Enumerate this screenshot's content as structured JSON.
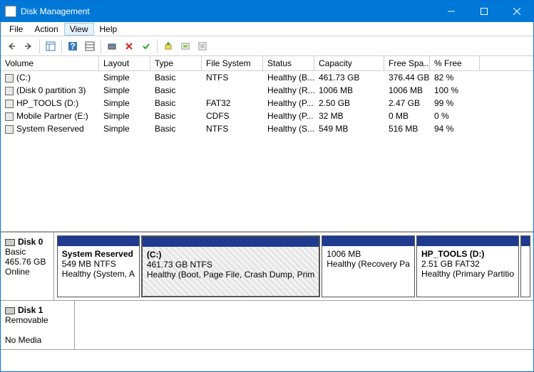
{
  "window": {
    "title": "Disk Management"
  },
  "menu": {
    "file": "File",
    "action": "Action",
    "view": "View",
    "help": "Help"
  },
  "columns": {
    "volume": "Volume",
    "layout": "Layout",
    "type": "Type",
    "fs": "File System",
    "status": "Status",
    "capacity": "Capacity",
    "free": "Free Spa...",
    "pct": "% Free"
  },
  "volumes": [
    {
      "name": "(C:)",
      "layout": "Simple",
      "type": "Basic",
      "fs": "NTFS",
      "status": "Healthy (B...",
      "capacity": "461.73 GB",
      "free": "376.44 GB",
      "pct": "82 %"
    },
    {
      "name": "(Disk 0 partition 3)",
      "layout": "Simple",
      "type": "Basic",
      "fs": "",
      "status": "Healthy (R...",
      "capacity": "1006 MB",
      "free": "1006 MB",
      "pct": "100 %"
    },
    {
      "name": "HP_TOOLS (D:)",
      "layout": "Simple",
      "type": "Basic",
      "fs": "FAT32",
      "status": "Healthy (P...",
      "capacity": "2.50 GB",
      "free": "2.47 GB",
      "pct": "99 %"
    },
    {
      "name": "Mobile Partner (E:)",
      "layout": "Simple",
      "type": "Basic",
      "fs": "CDFS",
      "status": "Healthy (P...",
      "capacity": "32 MB",
      "free": "0 MB",
      "pct": "0 %"
    },
    {
      "name": "System Reserved",
      "layout": "Simple",
      "type": "Basic",
      "fs": "NTFS",
      "status": "Healthy (S...",
      "capacity": "549 MB",
      "free": "516 MB",
      "pct": "94 %"
    }
  ],
  "disks": {
    "disk0": {
      "name": "Disk 0",
      "type": "Basic",
      "size": "465.76 GB",
      "status": "Online"
    },
    "disk1": {
      "name": "Disk 1",
      "type": "Removable",
      "status": "No Media"
    }
  },
  "partitions": {
    "p0": {
      "name": "System Reserved",
      "size": "549 MB NTFS",
      "status": "Healthy (System, A"
    },
    "p1": {
      "name": "(C:)",
      "size": "461.73 GB NTFS",
      "status": "Healthy (Boot, Page File, Crash Dump, Prim"
    },
    "p2": {
      "name": "",
      "size": "1006 MB",
      "status": "Healthy (Recovery Pa"
    },
    "p3": {
      "name": "HP_TOOLS  (D:)",
      "size": "2.51 GB FAT32",
      "status": "Healthy (Primary Partitio"
    }
  }
}
